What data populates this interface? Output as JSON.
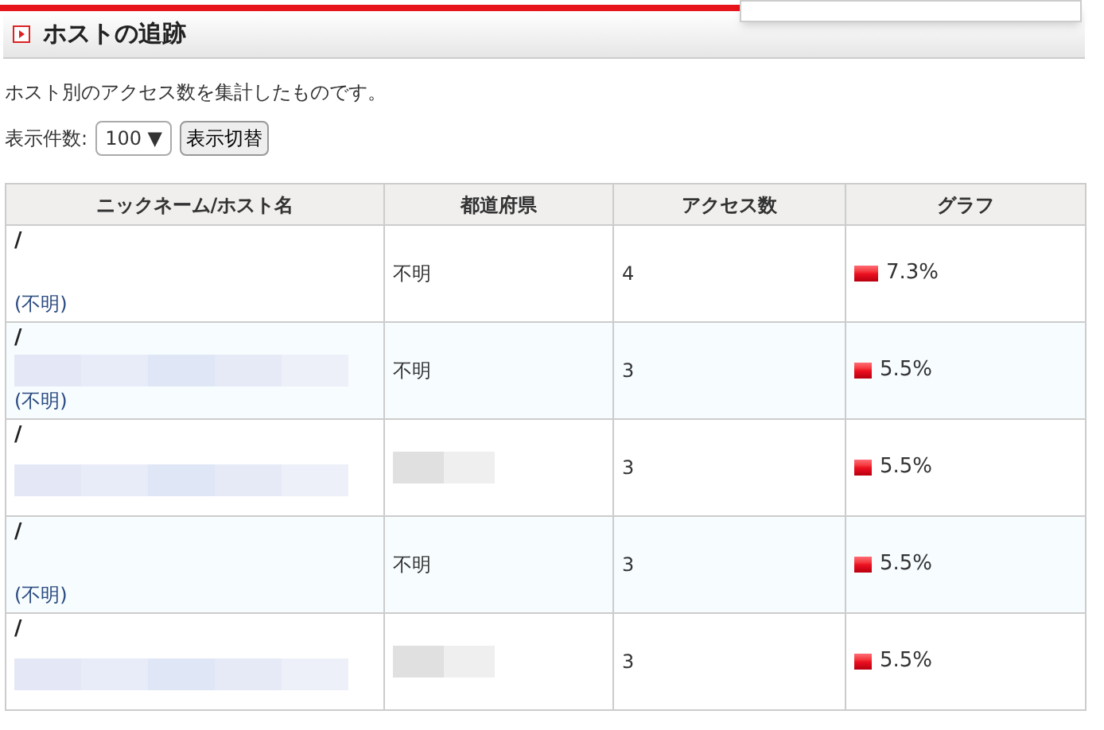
{
  "title": "ホストの追跡",
  "description": "ホスト別のアクセス数を集計したものです。",
  "count_control": {
    "label": "表示件数:",
    "value": "100 ▼",
    "button": "表示切替"
  },
  "table": {
    "columns": [
      "ニックネーム/ホスト名",
      "都道府県",
      "アクセス数",
      "グラフ"
    ],
    "rows": [
      {
        "nickname": "/",
        "host_redacted": false,
        "host_note": "(不明)",
        "prefecture_redacted": false,
        "prefecture": "不明",
        "count": "4",
        "level": 0.073,
        "percent": "7.3%"
      },
      {
        "nickname": "/",
        "host_redacted": true,
        "host_note": "(不明)",
        "prefecture_redacted": false,
        "prefecture": "不明",
        "count": "3",
        "level": 0.055,
        "percent": "5.5%"
      },
      {
        "nickname": "/",
        "host_redacted": true,
        "prefecture_redacted": true,
        "count": "3",
        "level": 0.055,
        "percent": "5.5%"
      },
      {
        "nickname": "/",
        "host_redacted": false,
        "host_note": "(不明)",
        "prefecture_redacted": false,
        "prefecture": "不明",
        "count": "3",
        "level": 0.055,
        "percent": "5.5%"
      },
      {
        "nickname": "/",
        "host_redacted": true,
        "prefecture_redacted": true,
        "count": "3",
        "level": 0.055,
        "percent": "5.5%"
      }
    ]
  }
}
